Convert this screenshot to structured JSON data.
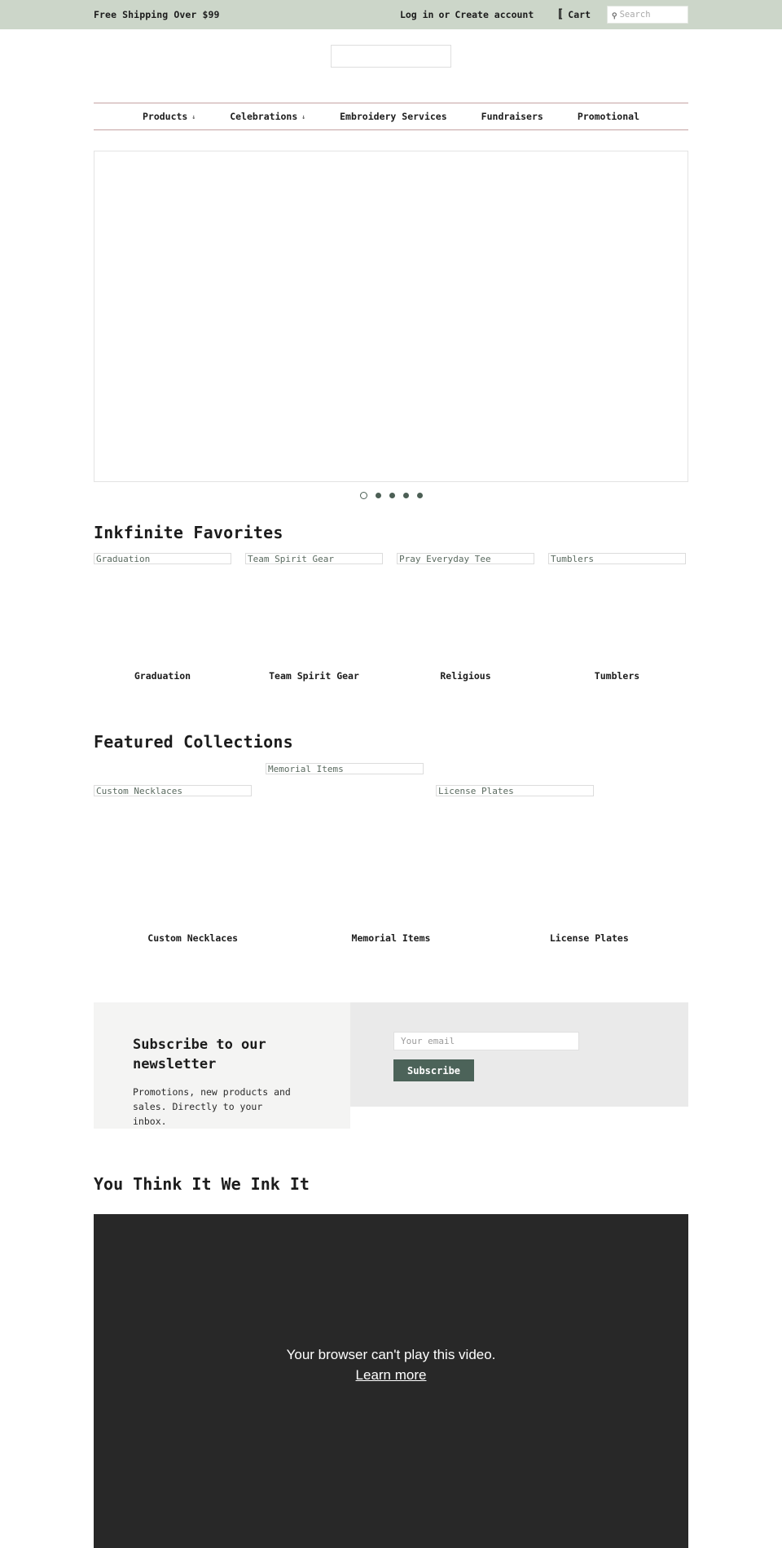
{
  "topbar": {
    "shipping_message": "Free Shipping Over $99",
    "login_label": "Log in",
    "or_label": "or",
    "create_account_label": "Create account",
    "cart_icon": "cart-icon",
    "cart_glyph": "〚",
    "cart_label": "Cart",
    "search_icon": "search-icon",
    "search_glyph": "⚲",
    "search_placeholder": "Search",
    "search_value": "",
    "background_color": "#ccd6c9"
  },
  "nav": {
    "border_color": "#c4a2a2",
    "items": [
      {
        "label": "Products",
        "has_dropdown": true,
        "caret": "↓"
      },
      {
        "label": "Celebrations",
        "has_dropdown": true,
        "caret": "↓"
      },
      {
        "label": "Embroidery Services",
        "has_dropdown": false,
        "caret": ""
      },
      {
        "label": "Fundraisers",
        "has_dropdown": false,
        "caret": ""
      },
      {
        "label": "Promotional",
        "has_dropdown": false,
        "caret": ""
      }
    ]
  },
  "slideshow": {
    "dots": [
      {
        "active": true
      },
      {
        "active": false
      },
      {
        "active": false
      },
      {
        "active": false
      },
      {
        "active": false
      }
    ],
    "dot_color": "#4c5f55"
  },
  "favorites": {
    "title": "Inkfinite Favorites",
    "items": [
      {
        "alt": "Graduation",
        "label": "Graduation"
      },
      {
        "alt": "Team Spirit Gear",
        "label": "Team Spirit Gear"
      },
      {
        "alt": "Pray Everyday Tee",
        "label": "Religious"
      },
      {
        "alt": "Tumblers",
        "label": "Tumblers"
      }
    ]
  },
  "featured": {
    "title": "Featured Collections",
    "items": [
      {
        "alt": "Custom Necklaces",
        "label": "Custom Necklaces"
      },
      {
        "alt": "Memorial Items",
        "label": "Memorial Items"
      },
      {
        "alt": "License Plates",
        "label": "License Plates"
      }
    ]
  },
  "newsletter": {
    "heading": "Subscribe to our newsletter",
    "body": "Promotions, new products and sales. Directly to your inbox.",
    "email_placeholder": "Your email",
    "email_value": "",
    "subscribe_label": "Subscribe",
    "button_color": "#4c6359"
  },
  "video": {
    "title": "You Think It We Ink It",
    "error_message": "Your browser can't play this video.",
    "learn_more_label": "Learn more",
    "background_color": "#282828"
  }
}
